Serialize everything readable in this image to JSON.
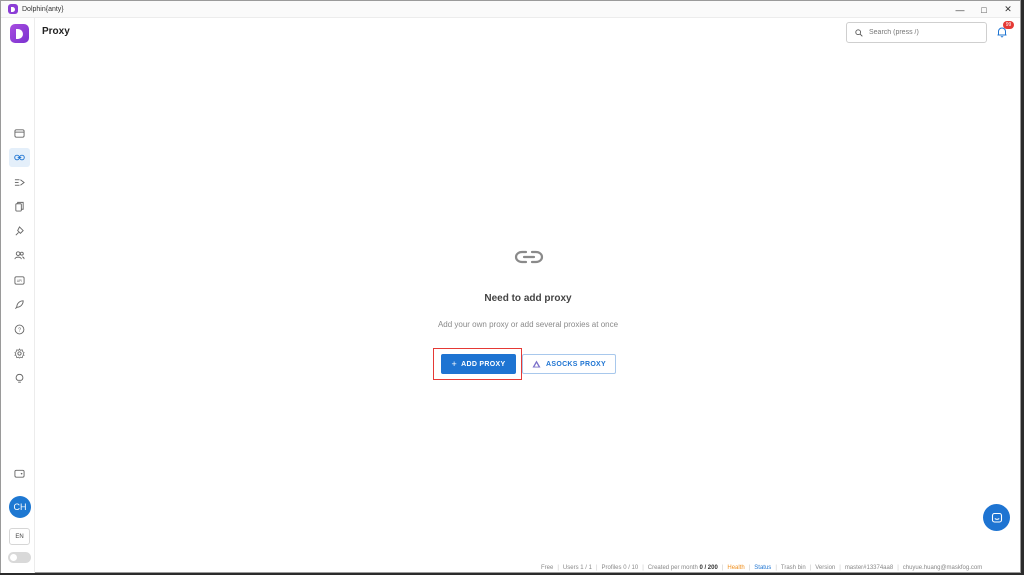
{
  "window": {
    "title": "Dolphin{anty}",
    "controls": [
      "minimize",
      "maximize",
      "close"
    ]
  },
  "header": {
    "page_title": "Proxy",
    "search_placeholder": "Search (press /)",
    "notification_count": "99"
  },
  "sidebar": {
    "items": [
      {
        "name": "browser-profiles",
        "icon": "window-icon",
        "active": false
      },
      {
        "name": "proxy",
        "icon": "link-icon",
        "active": true
      },
      {
        "name": "automation",
        "icon": "list-arrow-icon",
        "active": false
      },
      {
        "name": "extensions",
        "icon": "copy-icon",
        "active": false
      },
      {
        "name": "bookmarks",
        "icon": "pin-icon",
        "active": false
      },
      {
        "name": "users",
        "icon": "users-icon",
        "active": false
      },
      {
        "name": "api",
        "icon": "api-icon",
        "active": false
      },
      {
        "name": "launch",
        "icon": "rocket-icon",
        "active": false
      },
      {
        "name": "help",
        "icon": "help-icon",
        "active": false
      },
      {
        "name": "settings",
        "icon": "gear-icon",
        "active": false
      },
      {
        "name": "tips",
        "icon": "bulb-icon",
        "active": false
      }
    ],
    "wallet_icon": "wallet-icon",
    "avatar_initials": "CH",
    "language": "EN"
  },
  "empty_state": {
    "icon": "link-icon",
    "title": "Need to add proxy",
    "subtitle": "Add your own proxy or add several proxies at once",
    "add_button": "ADD PROXY",
    "asocks_button": "ASOCKS PROXY"
  },
  "statusbar": {
    "plan": "Free",
    "users_label": "Users",
    "users_value": "1 / 1",
    "profiles_label": "Profiles",
    "profiles_value": "0 / 10",
    "created_label": "Created per month",
    "created_value": "0 / 200",
    "health": "Health",
    "status": "Status",
    "trash": "Trash bin",
    "version": "Version",
    "branch": "master#13374aa8",
    "email": "chuyue.huang@maskfog.com"
  },
  "colors": {
    "accent": "#1e74d2",
    "brand": "#8b3dd6",
    "highlight": "#e53935",
    "health": "#f0901e"
  }
}
